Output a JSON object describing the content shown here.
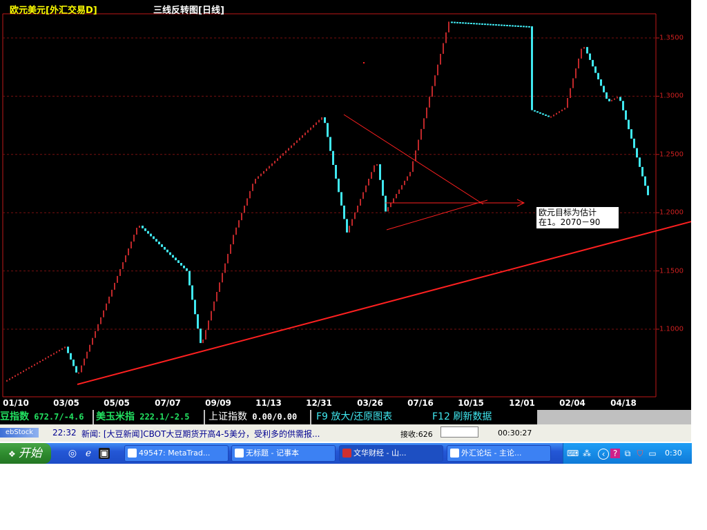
{
  "chart": {
    "symbol_title": "欧元美元[外汇交易D]",
    "chart_type": "三线反转图[日线]",
    "annotation": [
      "欧元目标为估计",
      "在1。2070－90"
    ],
    "x_ticks": [
      "01/10",
      "03/05",
      "05/05",
      "07/07",
      "09/09",
      "11/13",
      "12/31",
      "03/26",
      "07/16",
      "10/15",
      "12/01",
      "02/04",
      "04/18"
    ],
    "y_ticks": [
      "1.3500",
      "1.3000",
      "1.2500",
      "1.2000",
      "1.1500",
      "1.1000"
    ],
    "colors": {
      "up": "#c0282a",
      "down": "#40e8f0",
      "trendline": "#ff2020",
      "frame": "#c01818",
      "grid": "#7a1010"
    }
  },
  "chart_data": {
    "type": "line",
    "title": "三线反转图[日线]",
    "xlabel": "",
    "ylabel": "",
    "ylim": [
      1.05,
      1.37
    ],
    "categories": [
      "01/10",
      "03/05",
      "05/05",
      "07/07",
      "09/09",
      "11/13",
      "12/31",
      "03/26",
      "07/16",
      "10/15",
      "12/01",
      "02/04",
      "04/18"
    ],
    "series": [
      {
        "name": "欧元美元",
        "values": [
          1.085,
          1.06,
          1.19,
          1.15,
          1.085,
          1.181,
          1.228,
          1.283,
          1.183,
          1.245,
          1.201,
          1.235,
          1.364,
          1.288,
          1.345,
          1.295,
          1.215
        ]
      }
    ],
    "annotations": [
      "欧元目标为估计",
      "在1。2070－90"
    ],
    "grid": true
  },
  "info_bar": {
    "soybean_label": "豆指数",
    "soybean_value": "672.7/-4.6",
    "corn_label": "美玉米指",
    "corn_value": "222.1/-2.5",
    "shanghai_label": "上证指数",
    "shanghai_value": "0.00/0.00",
    "f9_label": "F9 放大/还原图表",
    "f12_label": "F12 刷新数据"
  },
  "news_bar": {
    "logo": "ebStock",
    "time": "22:32",
    "text": "新闻: [大豆新闻]CBOT大豆期货开高4-5美分，受利多的供需报...",
    "receive": "接收:626",
    "clock": "00:30:27"
  },
  "taskbar": {
    "start": "开始",
    "tasks": [
      "49547: MetaTrad...",
      "无标题 - 记事本",
      "文华财经 - 山...",
      "外汇论坛 - 主论..."
    ],
    "tray_time": "0:30"
  }
}
